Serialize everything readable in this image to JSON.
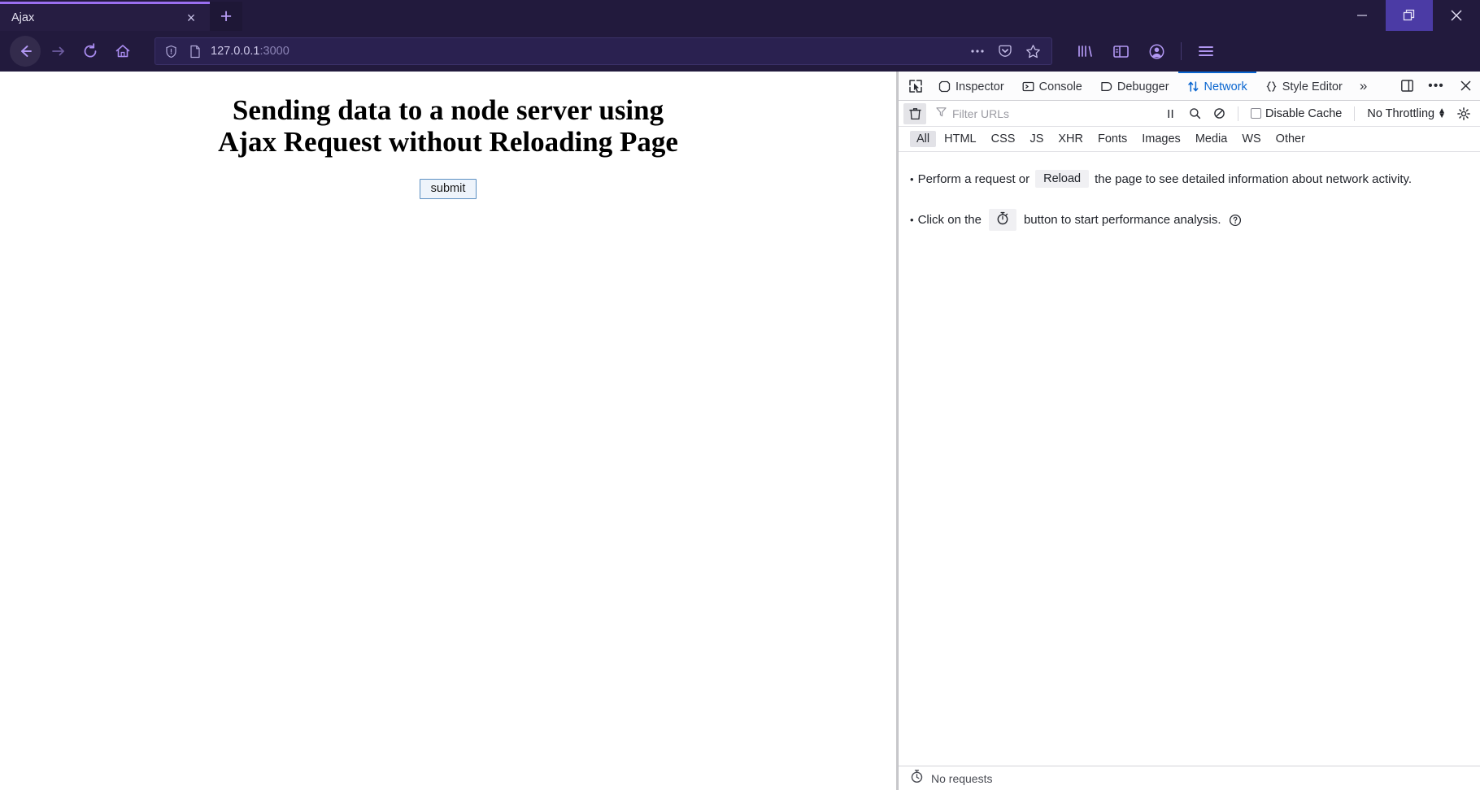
{
  "window": {
    "minimize_label": "Minimize",
    "restore_label": "Restore",
    "close_label": "Close"
  },
  "tabs": {
    "active": {
      "title": "Ajax",
      "close_label": "×"
    },
    "new_tab_label": "+"
  },
  "toolbar": {
    "back_label": "Back",
    "forward_label": "Forward",
    "reload_label": "Reload",
    "home_label": "Home",
    "url_host": "127.0.0.1",
    "url_port": ":3000",
    "page_actions_label": "•••",
    "pocket_label": "Save to Pocket",
    "bookmark_label": "Bookmark this page",
    "library_label": "Library",
    "sidebar_label": "Sidebars",
    "account_label": "Account",
    "menu_label": "Open menu"
  },
  "page": {
    "heading": "Sending data to a node server using Ajax Request without Reloading Page",
    "submit_label": "submit"
  },
  "devtools": {
    "picker_label": "Pick an element from the page",
    "tabs": [
      {
        "label": "Inspector",
        "icon": "inspector-icon",
        "selected": false
      },
      {
        "label": "Console",
        "icon": "console-icon",
        "selected": false
      },
      {
        "label": "Debugger",
        "icon": "debugger-icon",
        "selected": false
      },
      {
        "label": "Network",
        "icon": "network-icon",
        "selected": true
      },
      {
        "label": "Style Editor",
        "icon": "style-editor-icon",
        "selected": false
      }
    ],
    "overflow_label": "»",
    "dock_label": "Select dock position",
    "meatball_label": "•••",
    "close_label": "×",
    "accent_color": "#0a66d0",
    "toolbar": {
      "clear_label": "Clear",
      "filter_placeholder": "Filter URLs",
      "pause_label": "Pause",
      "search_label": "Search",
      "block_label": "Block",
      "disable_cache_label": "Disable Cache",
      "disable_cache_checked": false,
      "throttling_label": "No Throttling",
      "settings_label": "Network Settings"
    },
    "filters": [
      {
        "label": "All",
        "selected": true
      },
      {
        "label": "HTML",
        "selected": false
      },
      {
        "label": "CSS",
        "selected": false
      },
      {
        "label": "JS",
        "selected": false
      },
      {
        "label": "XHR",
        "selected": false
      },
      {
        "label": "Fonts",
        "selected": false
      },
      {
        "label": "Images",
        "selected": false
      },
      {
        "label": "Media",
        "selected": false
      },
      {
        "label": "WS",
        "selected": false
      },
      {
        "label": "Other",
        "selected": false
      }
    ],
    "empty_state": {
      "line1_before": "Perform a request or",
      "line1_button": "Reload",
      "line1_after": "the page to see detailed information about network activity.",
      "line2_before": "Click on the",
      "line2_button_icon": "stopwatch-icon",
      "line2_after": "button to start performance analysis.",
      "help_icon": "help-circle-icon",
      "bullet": "•"
    },
    "status": {
      "icon": "stopwatch-icon",
      "text": "No requests"
    }
  }
}
